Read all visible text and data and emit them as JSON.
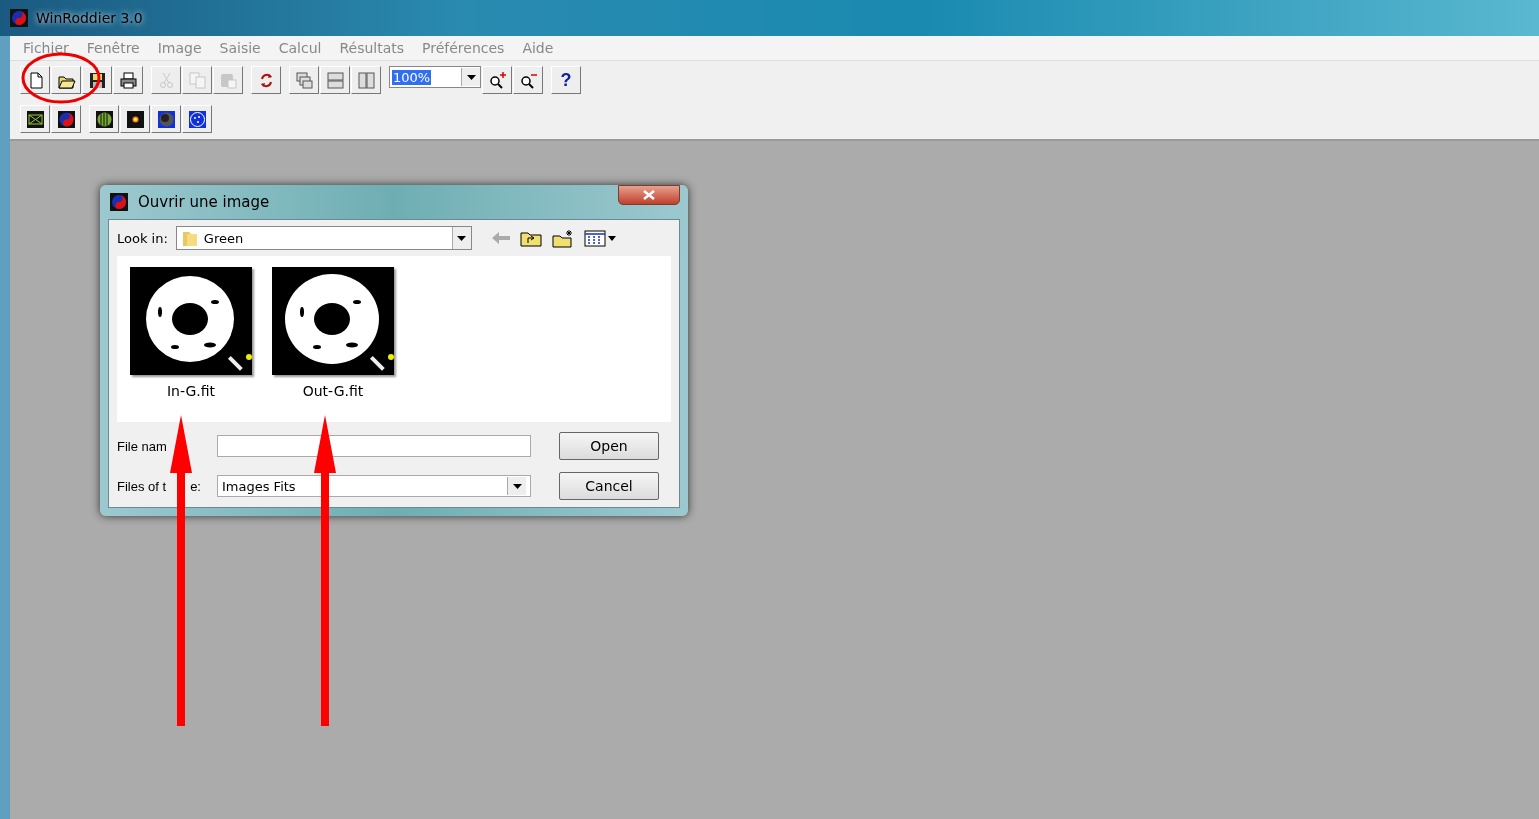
{
  "window": {
    "title": "WinRoddier 3.0"
  },
  "menu": [
    "Fichier",
    "Fenêtre",
    "Image",
    "Saisie",
    "Calcul",
    "Résultats",
    "Préférences",
    "Aide"
  ],
  "toolbar": {
    "groups": [
      [
        {
          "kind": "new",
          "disabled": false
        },
        {
          "kind": "open",
          "disabled": false
        },
        {
          "kind": "save",
          "disabled": false
        },
        {
          "kind": "print",
          "disabled": false
        }
      ],
      [
        {
          "kind": "cut",
          "disabled": true
        },
        {
          "kind": "copy",
          "disabled": true
        },
        {
          "kind": "paste",
          "disabled": true
        }
      ],
      [
        {
          "kind": "rotate",
          "disabled": false
        }
      ],
      [
        {
          "kind": "cascade",
          "disabled": false
        },
        {
          "kind": "tile-horizontal",
          "disabled": false
        },
        {
          "kind": "tile-vertical",
          "disabled": false
        }
      ],
      [
        {
          "kind": "combo",
          "value": "100%",
          "selected": true
        },
        {
          "kind": "zoom-in",
          "disabled": false
        },
        {
          "kind": "zoom-out",
          "disabled": false
        }
      ],
      [
        {
          "kind": "help",
          "label": "?",
          "disabled": false
        }
      ]
    ]
  },
  "toolbar2": {
    "groups": [
      [
        {
          "kind": "frame"
        },
        {
          "kind": "logo"
        }
      ],
      [
        {
          "kind": "grating"
        },
        {
          "kind": "star"
        },
        {
          "kind": "disk"
        },
        {
          "kind": "starfield"
        }
      ]
    ]
  },
  "dialog": {
    "title": "Ouvrir une image",
    "look_in": {
      "label": "Look in:",
      "value": "Green"
    },
    "files": [
      {
        "name": "In-G.fit",
        "kind": "picture"
      },
      {
        "name": "Out-G.fit",
        "kind": "picture"
      }
    ],
    "file_name": {
      "label": "File nam"
    },
    "file_type": {
      "label": "Files of t",
      "label_end": "e:",
      "value": "Images Fits"
    },
    "buttons": [
      "Open",
      "Cancel"
    ]
  },
  "annotations": [
    {
      "kind": "circle"
    },
    {
      "kind": "arrow"
    },
    {
      "kind": "arrow"
    }
  ]
}
